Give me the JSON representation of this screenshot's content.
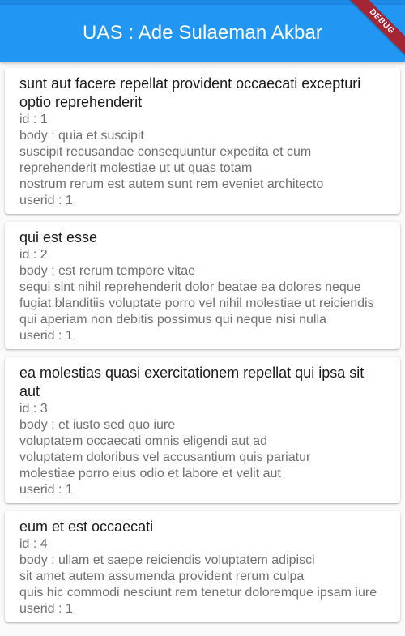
{
  "app_bar": {
    "title": "UAS : Ade Sulaeman Akbar",
    "debug_label": "DEBUG"
  },
  "labels": {
    "id_prefix": "id : ",
    "body_prefix": "body : ",
    "userid_prefix": "userid : "
  },
  "posts": [
    {
      "title": "sunt aut facere repellat provident occaecati excepturi optio reprehenderit",
      "id": "1",
      "body": "quia et suscipit\nsuscipit recusandae consequuntur expedita et cum\nreprehenderit molestiae ut ut quas totam\nnostrum rerum est autem sunt rem eveniet architecto",
      "userid": "1"
    },
    {
      "title": "qui est esse",
      "id": "2",
      "body": "est rerum tempore vitae\nsequi sint nihil reprehenderit dolor beatae ea dolores neque\nfugiat blanditiis voluptate porro vel nihil molestiae ut reiciendis\nqui aperiam non debitis possimus qui neque nisi nulla",
      "userid": "1"
    },
    {
      "title": "ea molestias quasi exercitationem repellat qui ipsa sit aut",
      "id": "3",
      "body": "et iusto sed quo iure\nvoluptatem occaecati omnis eligendi aut ad\nvoluptatem doloribus vel accusantium quis pariatur\nmolestiae porro eius odio et labore et velit aut",
      "userid": "1"
    },
    {
      "title": "eum et est occaecati",
      "id": "4",
      "body": "ullam et saepe reiciendis voluptatem adipisci\nsit amet autem assumenda provident rerum culpa\nquis hic commodi nesciunt rem tenetur doloremque ipsam iure",
      "userid": "1"
    }
  ]
}
